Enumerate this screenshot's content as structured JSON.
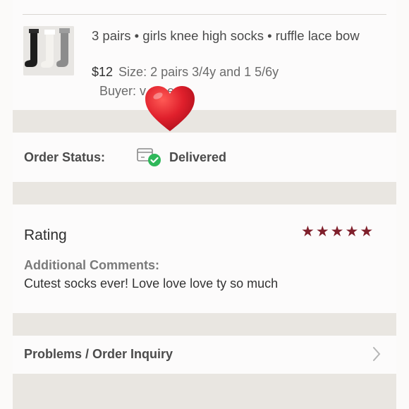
{
  "item": {
    "title": "3 pairs • girls knee high socks • ruffle lace bow",
    "price": "$12",
    "size": "Size: 2 pairs 3/4y and 1 5/6y",
    "buyer": "Buyer: v___e"
  },
  "order_status": {
    "label": "Order Status:",
    "value": "Delivered"
  },
  "rating": {
    "label": "Rating",
    "stars": 5,
    "star_color": "#7f1f2b",
    "comments_label": "Additional Comments:",
    "comments": "Cutest socks ever! Love love love ty so much"
  },
  "problems": {
    "label": "Problems / Order Inquiry"
  },
  "icons": {
    "heart": "heart-emoji-icon",
    "delivered": "delivered-box-check-icon",
    "stars": "star-icon",
    "chevron": "chevron-right-icon"
  },
  "colors": {
    "delivered_check": "#2fb85a",
    "heart": "#e0202c",
    "page_gap": "#e9e6e1"
  }
}
